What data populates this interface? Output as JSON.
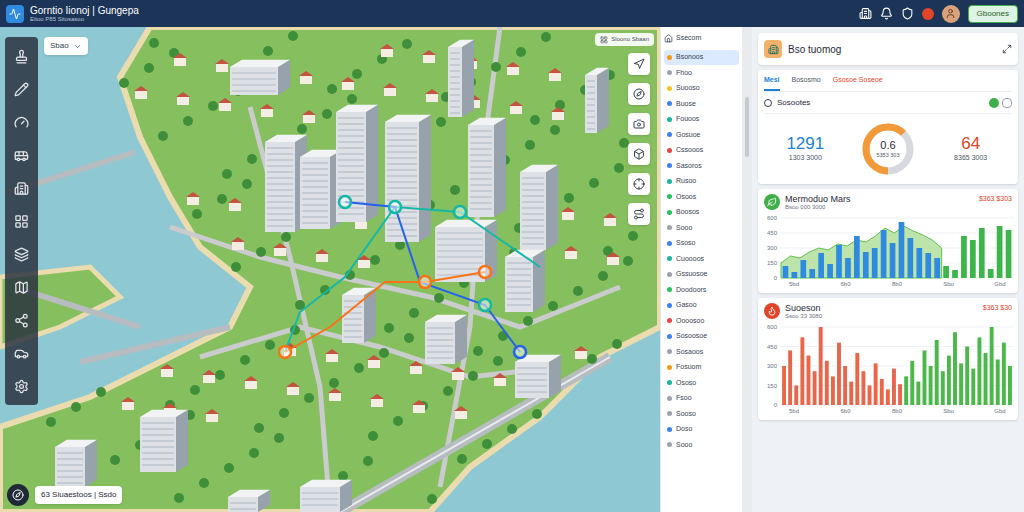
{
  "header": {
    "title": "Gorntio Iionoj | Gungepa",
    "subtitle": "Eitoo P85 Sitosasoo",
    "button": "Gboones"
  },
  "map": {
    "search": "Sbao",
    "layer_label": "Sloono Sbaan",
    "status": "63 Siuaestoos | Ssdo"
  },
  "list": {
    "header": "Ssecom",
    "items": [
      {
        "label": "Bsonoos",
        "selected": true,
        "color": "#f59e0b"
      },
      {
        "label": "Fhoo",
        "selected": false,
        "color": "#9ca3af"
      },
      {
        "label": "Suooso",
        "selected": false,
        "color": "#f5c518"
      },
      {
        "label": "Buose",
        "selected": false,
        "color": "#3b82f6"
      },
      {
        "label": "Fouoos",
        "selected": false,
        "color": "#14b8a6"
      },
      {
        "label": "Gosuoe",
        "selected": false,
        "color": "#3b82f6"
      },
      {
        "label": "Cssooos",
        "selected": false,
        "color": "#ef4444"
      },
      {
        "label": "Sasoros",
        "selected": false,
        "color": "#3b82f6"
      },
      {
        "label": "Rusoo",
        "selected": false,
        "color": "#14b8a6"
      },
      {
        "label": "Osoos",
        "selected": false,
        "color": "#22c55e"
      },
      {
        "label": "Boosos",
        "selected": false,
        "color": "#22c55e"
      },
      {
        "label": "Sooo",
        "selected": false,
        "color": "#9ca3af"
      },
      {
        "label": "Ssoso",
        "selected": false,
        "color": "#3b82f6"
      },
      {
        "label": "Cuoooos",
        "selected": false,
        "color": "#14b8a6"
      },
      {
        "label": "Gssuosoe",
        "selected": false,
        "color": "#9ca3af"
      },
      {
        "label": "Doodoors",
        "selected": false,
        "color": "#22c55e"
      },
      {
        "label": "Gasoo",
        "selected": false,
        "color": "#3b82f6"
      },
      {
        "label": "Oooosoo",
        "selected": false,
        "color": "#ef4444"
      },
      {
        "label": "Sosoosoe",
        "selected": false,
        "color": "#3b82f6"
      },
      {
        "label": "Sosaoos",
        "selected": false,
        "color": "#9ca3af"
      },
      {
        "label": "Fosuom",
        "selected": false,
        "color": "#f59e0b"
      },
      {
        "label": "Ososo",
        "selected": false,
        "color": "#14b8a6"
      },
      {
        "label": "Fsoo",
        "selected": false,
        "color": "#9ca3af"
      },
      {
        "label": "Sooso",
        "selected": false,
        "color": "#9ca3af"
      },
      {
        "label": "Doso",
        "selected": false,
        "color": "#3b82f6"
      },
      {
        "label": "Sooo",
        "selected": false,
        "color": "#9ca3af"
      }
    ]
  },
  "detail": {
    "title": "Bso tuomog",
    "tabs": [
      {
        "label": "Mesi",
        "selected": true,
        "color": "#1d7fd6"
      },
      {
        "label": "Bososmo",
        "selected": false,
        "color": "#4b5563"
      },
      {
        "label": "Gsosoe Soseoe",
        "selected": false,
        "color": "#e0452a"
      }
    ],
    "section": {
      "label": "Sosootes",
      "on": true
    },
    "stats": [
      {
        "value": "1291",
        "sub": "1303 3000",
        "color": "#1d7fd6"
      },
      {
        "value": "64",
        "sub": "8365 3003",
        "color": "#e0452a"
      }
    ],
    "gauge": {
      "value": "0.6",
      "sub": "5353 303",
      "level": 0.62
    }
  },
  "charts": [
    {
      "title": "Mermoduo Mars",
      "subtitle": "Bsoo 000 3000",
      "reading": "$363 $303",
      "kind": "leaf",
      "y_ticks": [
        "600",
        "450",
        "300",
        "150",
        "0"
      ],
      "x_ticks": [
        "5bd",
        "6b0",
        "8b0",
        "Sbu",
        "Gbd"
      ],
      "series": [
        {
          "kind": "area",
          "color": "#a7dc8f",
          "values": [
            150,
            220,
            200,
            260,
            300,
            280,
            340,
            320,
            380,
            360,
            420,
            500,
            450,
            520,
            470,
            430,
            380,
            300
          ]
        },
        {
          "kind": "bar",
          "color": "#2f8be0",
          "values": [
            120,
            60,
            180,
            90,
            250,
            140,
            330,
            200,
            420,
            260,
            300,
            480,
            350,
            560,
            400,
            300,
            250,
            200
          ]
        },
        {
          "kind": "bar",
          "color": "#3cb54a",
          "values": [
            120,
            80,
            420,
            380,
            500,
            90,
            520,
            480
          ]
        }
      ]
    },
    {
      "title": "Suoeson",
      "subtitle": "Ssoo 33 3080",
      "reading": "$363 $30",
      "kind": "flame",
      "y_ticks": [
        "600",
        "450",
        "300",
        "150",
        "0"
      ],
      "x_ticks": [
        "5bd",
        "6b0",
        "8b0",
        "Sbu",
        "Gbd"
      ],
      "series": [
        {
          "kind": "bar",
          "color": "#e8674a",
          "values": [
            300,
            420,
            150,
            520,
            380,
            260,
            600,
            340,
            220,
            480,
            300,
            180,
            400,
            260,
            150,
            320,
            200,
            120,
            280,
            160
          ]
        },
        {
          "kind": "bar",
          "color": "#4cb84a",
          "values": [
            220,
            340,
            180,
            420,
            300,
            500,
            260,
            380,
            560,
            320,
            450,
            280,
            520,
            400,
            600,
            350,
            480,
            300
          ]
        }
      ]
    }
  ]
}
